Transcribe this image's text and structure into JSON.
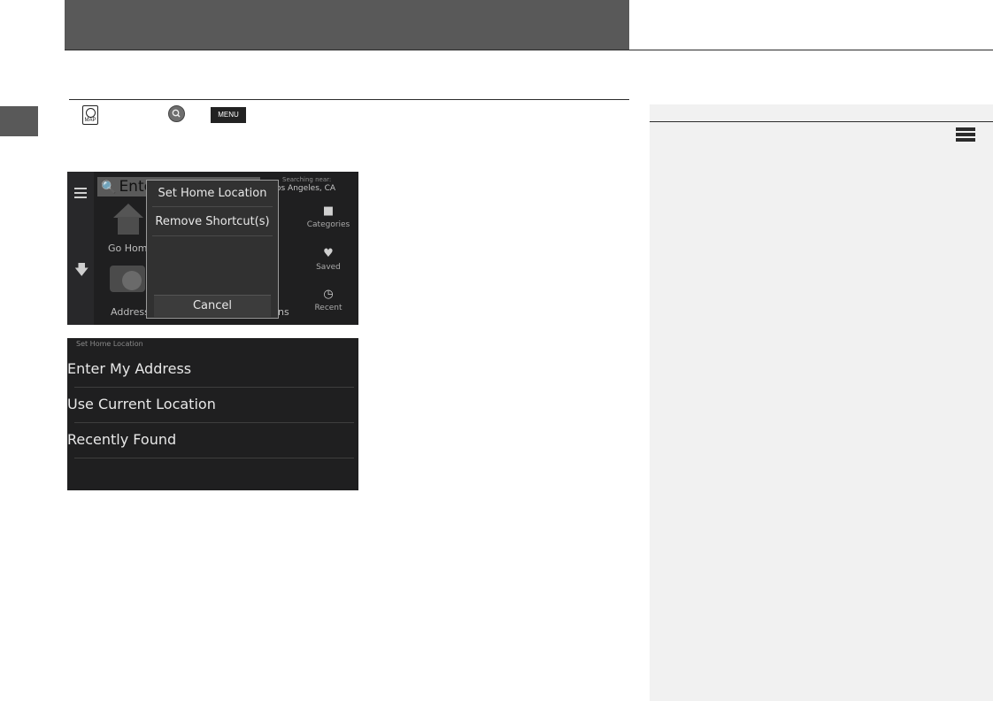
{
  "header": {},
  "instruction_buttons": {
    "map_label": "MAP",
    "menu_label": "MENU"
  },
  "screen1": {
    "search_text": "Ente",
    "searching_near_label": "Searching near:",
    "searching_near_value": "os Angeles, CA",
    "go_home_label": "Go Hom",
    "address_label": "Address",
    "partial_label": "ns",
    "side_buttons": [
      {
        "label": "Categories",
        "icon": "chat-bubble-icon"
      },
      {
        "label": "Saved",
        "icon": "heart-icon"
      },
      {
        "label": "Recent",
        "icon": "clock-icon"
      }
    ],
    "popup": {
      "items": [
        "Set Home Location",
        "Remove Shortcut(s)"
      ],
      "cancel_label": "Cancel"
    }
  },
  "screen2": {
    "title": "Set Home Location",
    "items": [
      "Enter My Address",
      "Use Current Location",
      "Recently Found"
    ]
  }
}
